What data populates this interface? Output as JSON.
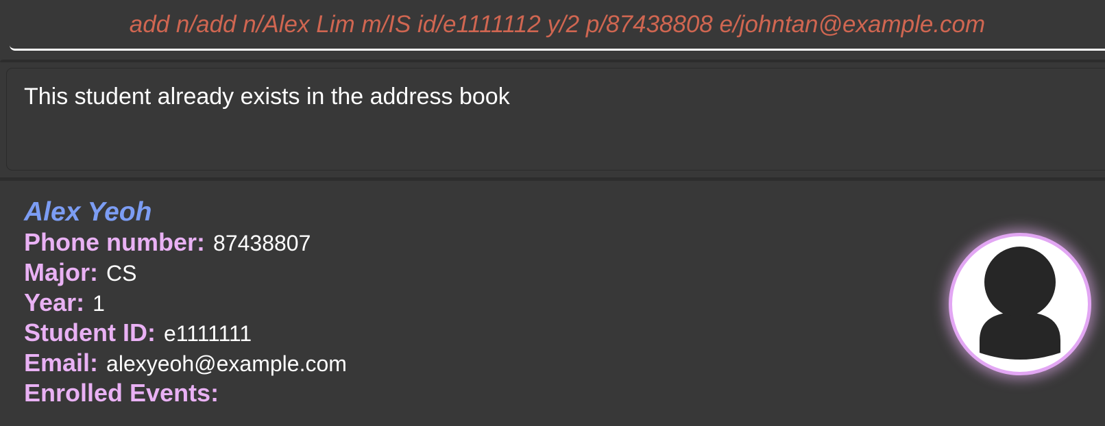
{
  "command_box": {
    "value": "add n/add n/Alex Lim m/IS id/e1111112 y/2 p/87438808 e/johntan@example.com"
  },
  "result_display": {
    "message": "This student already exists in the address book"
  },
  "person_card": {
    "name": "Alex Yeoh",
    "phone_label": "Phone number:",
    "phone": "87438807",
    "major_label": "Major:",
    "major": "CS",
    "year_label": "Year:",
    "year": "1",
    "student_id_label": "Student ID:",
    "student_id": "e1111111",
    "email_label": "Email:",
    "email": "alexyeoh@example.com",
    "events_label": "Enrolled Events:",
    "avatar_icon": "user-avatar-icon"
  },
  "colors": {
    "background": "#383838",
    "command_text": "#d06651",
    "name": "#7c9df4",
    "label": "#e9b1f4",
    "value": "#ffffff"
  }
}
